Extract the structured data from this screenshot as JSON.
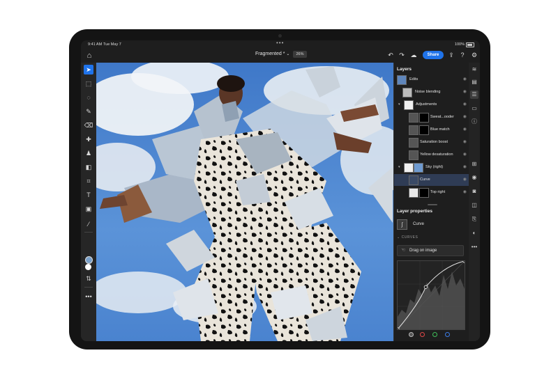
{
  "status": {
    "time": "9:41 AM",
    "date": "Tue May 7",
    "battery": "100%"
  },
  "topbar": {
    "title": "Fragmented",
    "title_suffix": " *",
    "zoom": "26%",
    "share_label": "Share"
  },
  "layers_panel": {
    "title": "Layers",
    "layers": [
      {
        "label": "Edits",
        "indent": 0,
        "caret": false,
        "selected": false
      },
      {
        "label": "Noise blending",
        "indent": 1,
        "caret": false,
        "selected": false
      },
      {
        "label": "Adjustments",
        "indent": 1,
        "caret": true,
        "selected": false
      },
      {
        "label": "Sweat...ooder",
        "indent": 2,
        "caret": false,
        "selected": false
      },
      {
        "label": "Blue match",
        "indent": 2,
        "caret": false,
        "selected": false
      },
      {
        "label": "Saturation boost",
        "indent": 2,
        "caret": false,
        "selected": false
      },
      {
        "label": "Yellow desaturation",
        "indent": 2,
        "caret": false,
        "selected": false
      },
      {
        "label": "Sky (right)",
        "indent": 1,
        "caret": true,
        "selected": false
      },
      {
        "label": "Curve",
        "indent": 2,
        "caret": false,
        "selected": true
      },
      {
        "label": "Top right",
        "indent": 2,
        "caret": false,
        "selected": false
      }
    ]
  },
  "properties": {
    "title": "Layer properties",
    "layer_name": "Curve",
    "section": "CURVES",
    "drag_label": "Drag on image",
    "curve_points": [
      [
        0,
        0
      ],
      [
        0.42,
        0.62
      ],
      [
        1,
        1
      ]
    ],
    "channels": [
      {
        "name": "composite",
        "color": "#bbbbbb"
      },
      {
        "name": "red",
        "color": "#e04848"
      },
      {
        "name": "green",
        "color": "#3fbf5a"
      },
      {
        "name": "blue",
        "color": "#3d7de8"
      }
    ]
  },
  "colors": {
    "accent": "#1f73ea",
    "fg_swatch": "#7aa0c8",
    "bg_swatch": "#ffffff"
  }
}
